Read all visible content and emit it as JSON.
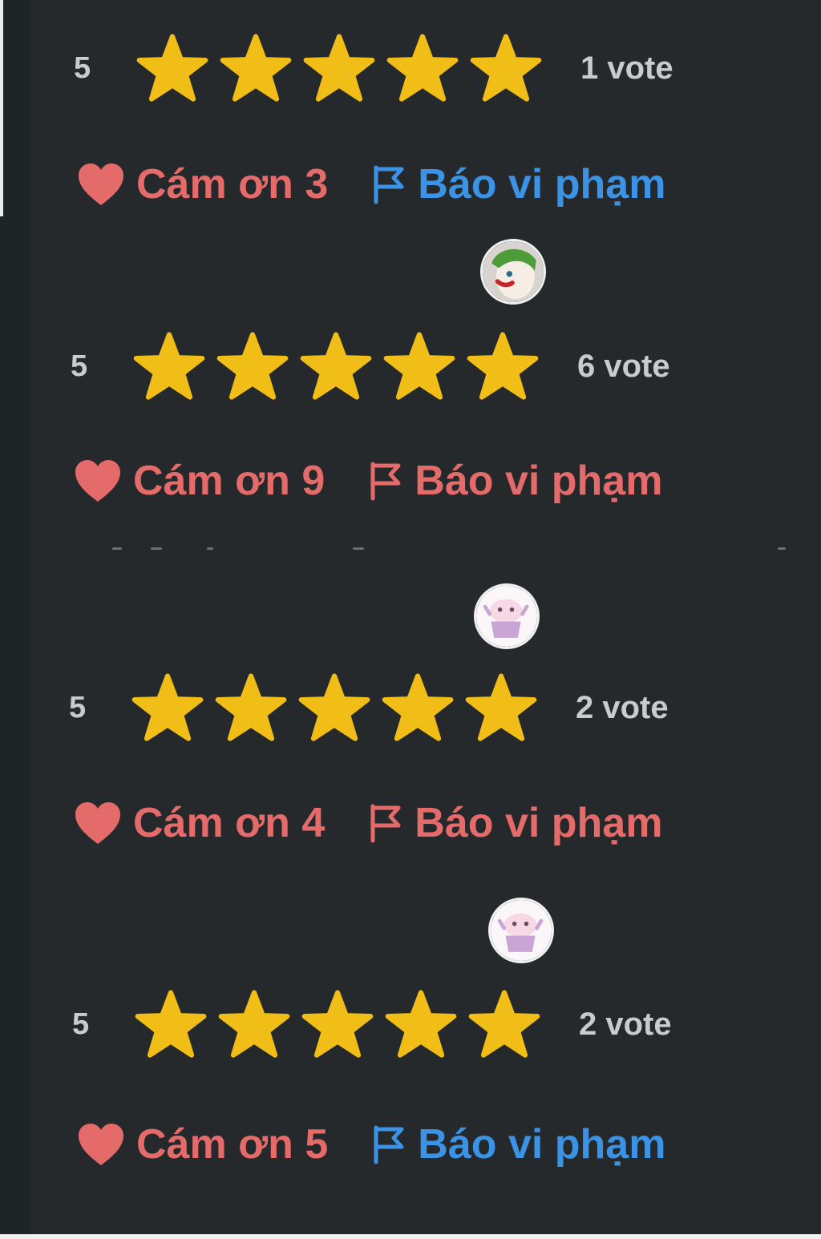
{
  "colors": {
    "background": "#26292b",
    "star": "#f1bd17",
    "thanks": "#e56b6b",
    "report_blue": "#3b93e6",
    "report_red": "#e56b6b",
    "muted_text": "#c9cccf"
  },
  "icons": {
    "star": "star-icon",
    "heart": "heart-icon",
    "flag": "flag-icon",
    "avatar": "avatar"
  },
  "reviews": [
    {
      "score": "5",
      "rating": 5,
      "votes": "1 vote",
      "thanks": "Cám ơn 3",
      "report": "Báo vi phạm",
      "report_color": "#3b93e6"
    },
    {
      "score": "5",
      "rating": 5,
      "votes": "6 vote",
      "thanks": "Cám ơn 9",
      "report": "Báo vi phạm",
      "report_color": "#e56b6b"
    },
    {
      "score": "5",
      "rating": 5,
      "votes": "2 vote",
      "thanks": "Cám ơn 4",
      "report": "Báo vi phạm",
      "report_color": "#e56b6b"
    },
    {
      "score": "5",
      "rating": 5,
      "votes": "2 vote",
      "thanks": "Cám ơn 5",
      "report": "Báo vi phạm",
      "report_color": "#3b93e6"
    }
  ]
}
